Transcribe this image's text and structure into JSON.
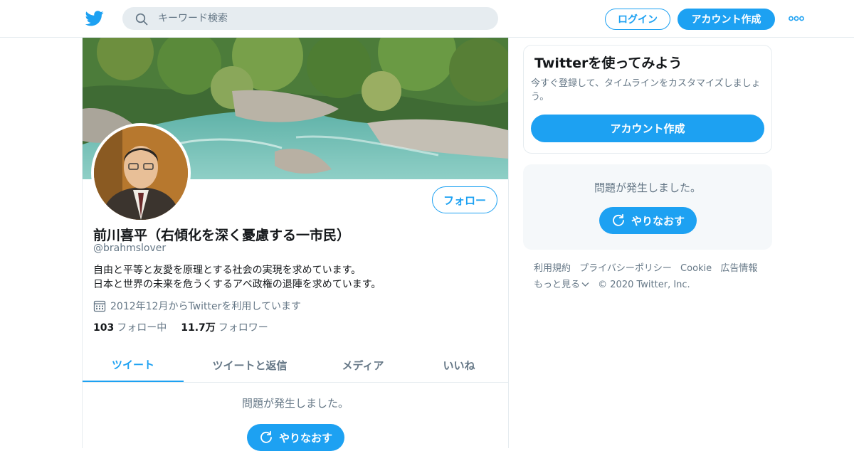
{
  "header": {
    "search_placeholder": "キーワード検索",
    "login_label": "ログイン",
    "signup_label": "アカウント作成"
  },
  "profile": {
    "follow_label": "フォロー",
    "name": "前川喜平（右傾化を深く憂慮する一市民）",
    "handle": "@brahmslover",
    "bio_line1": "自由と平等と友愛を原理とする社会の実現を求めています。",
    "bio_line2": "日本と世界の未来を危うくするアベ政権の退陣を求めています。",
    "joined": "2012年12月からTwitterを利用しています",
    "following_count": "103",
    "following_label": "フォロー中",
    "followers_count": "11.7万",
    "followers_label": "フォロワー"
  },
  "tabs": [
    {
      "label": "ツイート",
      "active": true
    },
    {
      "label": "ツイートと返信",
      "active": false
    },
    {
      "label": "メディア",
      "active": false
    },
    {
      "label": "いいね",
      "active": false
    }
  ],
  "timeline": {
    "error_text": "問題が発生しました。",
    "retry_label": "やりなおす"
  },
  "sidebar": {
    "signup_title": "Twitterを使ってみよう",
    "signup_desc": "今すぐ登録して、タイムラインをカスタマイズしましょう。",
    "signup_button": "アカウント作成",
    "error_text": "問題が発生しました。",
    "retry_label": "やりなおす"
  },
  "footer": {
    "links": [
      "利用規約",
      "プライバシーポリシー",
      "Cookie",
      "広告情報"
    ],
    "more_label": "もっと見る",
    "copyright": "© 2020 Twitter, Inc."
  },
  "colors": {
    "accent": "#1da1f2",
    "text_secondary": "#657786",
    "border": "#e6ecf0"
  },
  "icons": {
    "logo": "twitter-bird-icon",
    "search": "search-icon",
    "more": "more-dots-icon",
    "calendar": "calendar-icon",
    "retry": "refresh-icon",
    "chevron": "chevron-down-icon"
  }
}
